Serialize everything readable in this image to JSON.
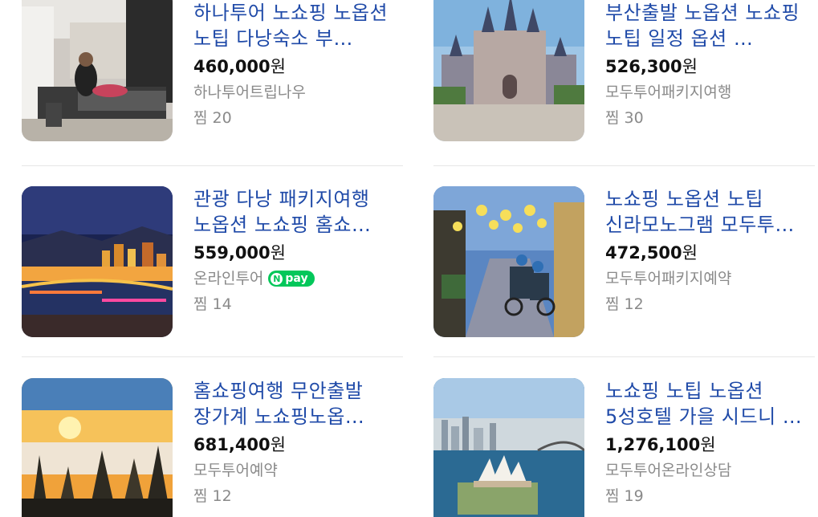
{
  "products": [
    {
      "title": "하나투어 노쇼핑 노옵션 노팁 다낭숙소 부…",
      "price": "460,000",
      "currency": "원",
      "seller": "하나투어트립나우",
      "npay": false,
      "zzim": "찜 20",
      "image": "spa-massage-photo"
    },
    {
      "title": "부산출발 노옵션 노쇼핑 노팁 일정 옵션 …",
      "price": "526,300",
      "currency": "원",
      "seller": "모두투어패키지여행",
      "npay": false,
      "zzim": "찜 30",
      "image": "castle-photo"
    },
    {
      "title": "관광 다낭 패키지여행 노옵션 노쇼핑 홈쇼…",
      "price": "559,000",
      "currency": "원",
      "seller": "온라인투어",
      "npay": true,
      "npay_label": "pay",
      "zzim": "찜 14",
      "image": "city-night-photo"
    },
    {
      "title": "노쇼핑 노옵션 노팁 신라모노그램 모두투…",
      "price": "472,500",
      "currency": "원",
      "seller": "모두투어패키지예약",
      "npay": false,
      "zzim": "찜 12",
      "image": "lantern-street-photo"
    },
    {
      "title": "홈쇼핑여행 무안출발 장가계 노쇼핑노옵…",
      "price": "681,400",
      "currency": "원",
      "seller": "모두투어예약",
      "npay": false,
      "zzim": "찜 12",
      "image": "mountain-sunrise-photo"
    },
    {
      "title": "노쇼핑 노팁 노옵션 5성호텔 가을 시드니 …",
      "price": "1,276,100",
      "currency": "원",
      "seller": "모두투어온라인상담",
      "npay": false,
      "zzim": "찜 19",
      "image": "sydney-harbour-photo"
    }
  ]
}
